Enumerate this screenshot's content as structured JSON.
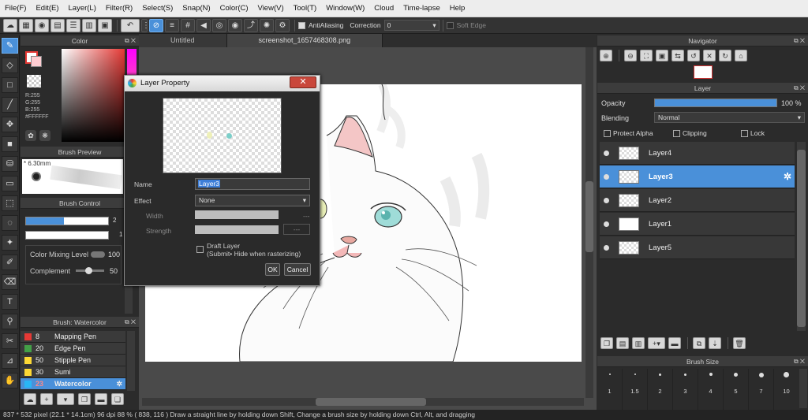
{
  "menu": [
    "File(F)",
    "Edit(E)",
    "Layer(L)",
    "Filter(R)",
    "Select(S)",
    "Snap(N)",
    "Color(C)",
    "View(V)",
    "Tool(T)",
    "Window(W)",
    "Cloud",
    "Time-lapse",
    "Help"
  ],
  "toolbar": {
    "antialiasing_label": "AntiAliasing",
    "correction_label": "Correction",
    "correction_value": "0",
    "soft_edge_label": "Soft Edge"
  },
  "color_panel": {
    "title": "Color",
    "r": "R:255",
    "g": "G:255",
    "b": "B:255",
    "hex": "#FFFFFF"
  },
  "brush_preview": {
    "title": "Brush Preview",
    "size": "6.30mm"
  },
  "brush_control": {
    "title": "Brush Control",
    "color_mixing_label": "Color Mixing Level",
    "color_mixing_value": "100",
    "complement_label": "Complement",
    "complement_value": "50",
    "size_value": "2",
    "opacity_value": "1"
  },
  "brush_list": {
    "title": "Brush: Watercolor",
    "items": [
      {
        "num": "8",
        "name": "Mapping Pen",
        "color": "#e53935"
      },
      {
        "num": "20",
        "name": "Edge Pen",
        "color": "#43a047"
      },
      {
        "num": "50",
        "name": "Stipple Pen",
        "color": "#fdd835"
      },
      {
        "num": "30",
        "name": "Sumi",
        "color": "#fdd835"
      },
      {
        "num": "23",
        "name": "Watercolor",
        "color": "#29b6f6"
      }
    ]
  },
  "tabs": [
    "Untitled",
    "screenshot_1657468308.png"
  ],
  "dialog": {
    "title": "Layer Property",
    "name_label": "Name",
    "name_value": "Layer3",
    "effect_label": "Effect",
    "effect_value": "None",
    "width_label": "Width",
    "strength_label": "Strength",
    "width_value": "---",
    "strength_value": "---",
    "draft_label": "Draft Layer",
    "draft_sub": "(Submit• Hide when rasterizing)",
    "ok": "OK",
    "cancel": "Cancel"
  },
  "navigator": {
    "title": "Navigator"
  },
  "layer_panel": {
    "title": "Layer",
    "opacity_label": "Opacity",
    "opacity_value": "100 %",
    "opacity_fraction": 1.0,
    "blending_label": "Blending",
    "blending_value": "Normal",
    "protect_alpha": "Protect Alpha",
    "clipping": "Clipping",
    "lock": "Lock",
    "layers": [
      {
        "name": "Layer4"
      },
      {
        "name": "Layer3"
      },
      {
        "name": "Layer2"
      },
      {
        "name": "Layer1"
      },
      {
        "name": "Layer5"
      }
    ]
  },
  "brush_size": {
    "title": "Brush Size",
    "sizes": [
      "1",
      "1.5",
      "2",
      "3",
      "4",
      "5",
      "7",
      "10"
    ]
  },
  "status": "837 * 532 pixel   (22.1 * 14.1cm)   96 dpi   88 %   ( 838, 116 )   Draw a straight line by holding down Shift, Change a brush size by holding down Ctrl, Alt, and dragging",
  "colors": {
    "accent": "#4a90d9",
    "panel": "#2b2b2b"
  }
}
